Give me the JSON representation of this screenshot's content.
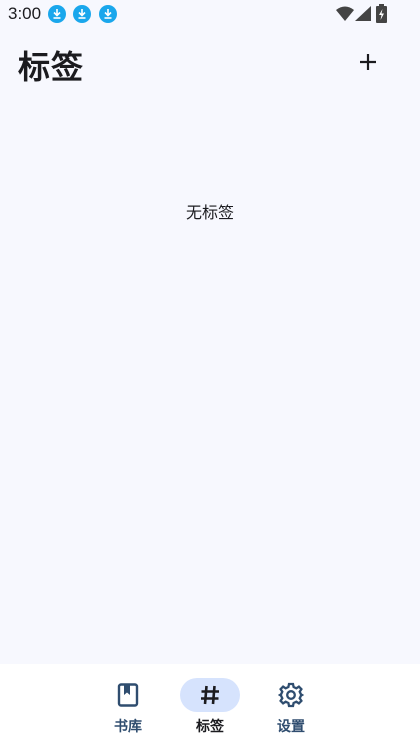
{
  "status_bar": {
    "time": "3:00",
    "notification_icons": [
      "download-icon",
      "download-icon",
      "download-icon"
    ],
    "system_icons": [
      "wifi-icon",
      "signal-icon",
      "battery-charging-icon"
    ],
    "accent_color": "#1aa7ec"
  },
  "header": {
    "title": "标签",
    "add_icon": "plus-icon"
  },
  "main": {
    "empty_message": "无标签"
  },
  "bottom_nav": {
    "items": [
      {
        "label": "书库",
        "icon": "book-icon",
        "active": false
      },
      {
        "label": "标签",
        "icon": "hash-icon",
        "active": true
      },
      {
        "label": "设置",
        "icon": "gear-icon",
        "active": false
      }
    ],
    "active_indicator_color": "#d6e3fd",
    "label_color": "#2f4d6f"
  },
  "colors": {
    "background": "#f7f8fe",
    "nav_background": "#ffffff"
  }
}
